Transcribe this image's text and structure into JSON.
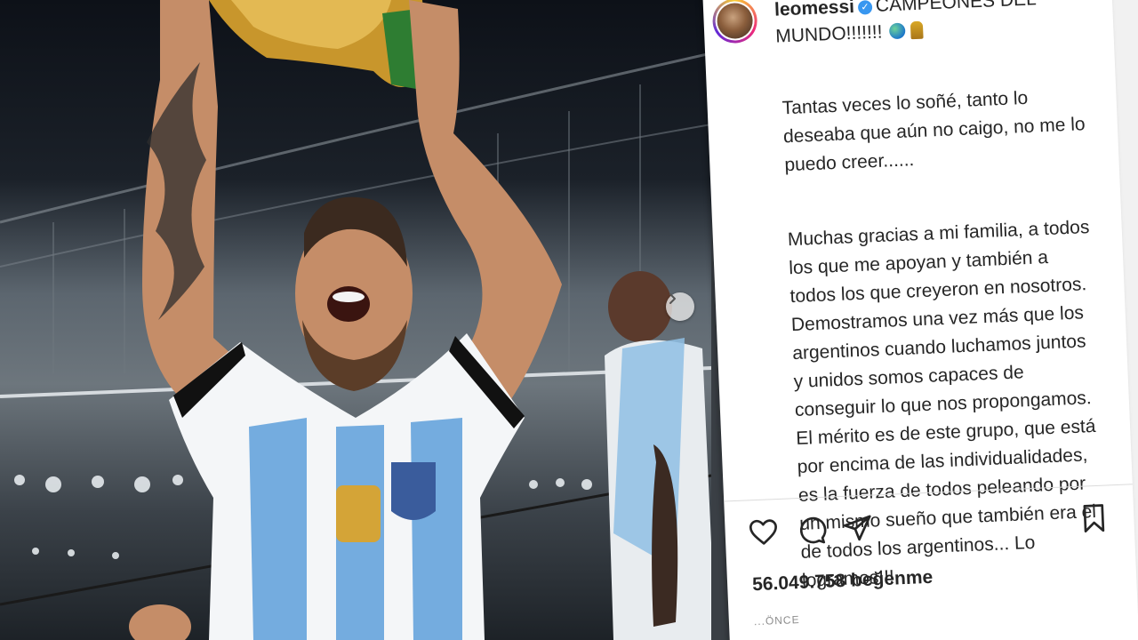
{
  "post": {
    "username": "leomessi",
    "caption_title": "CAMPEONES DEL MUNDO!!!!!!!",
    "paragraphs": [
      "Tantas veces lo soñé, tanto lo deseaba que aún no caigo, no me lo puedo creer......",
      "Muchas gracias a mi familia, a todos los que me apoyan y también a todos los que creyeron en nosotros. Demostramos una vez más que los argentinos cuando luchamos juntos y unidos somos capaces de conseguir lo que nos propongamos. El mérito es de este grupo, que está por encima de las individualidades, es la fuerza de todos peleando por un mismo sueño que también era el de todos los argentinos... Lo logramos!!!"
    ],
    "likes_count": "56.049.758",
    "likes_word": "beğenme",
    "time_label": "...ÖNCE"
  },
  "icons": {
    "verified": "verified-badge-icon",
    "like": "heart-icon",
    "comment": "comment-icon",
    "share": "paper-plane-icon",
    "save": "bookmark-icon",
    "next": "chevron-right-icon"
  },
  "colors": {
    "text": "#262626",
    "verified": "#3897f0",
    "jersey_blue": "#74acdf",
    "gold": "#d4a437"
  }
}
